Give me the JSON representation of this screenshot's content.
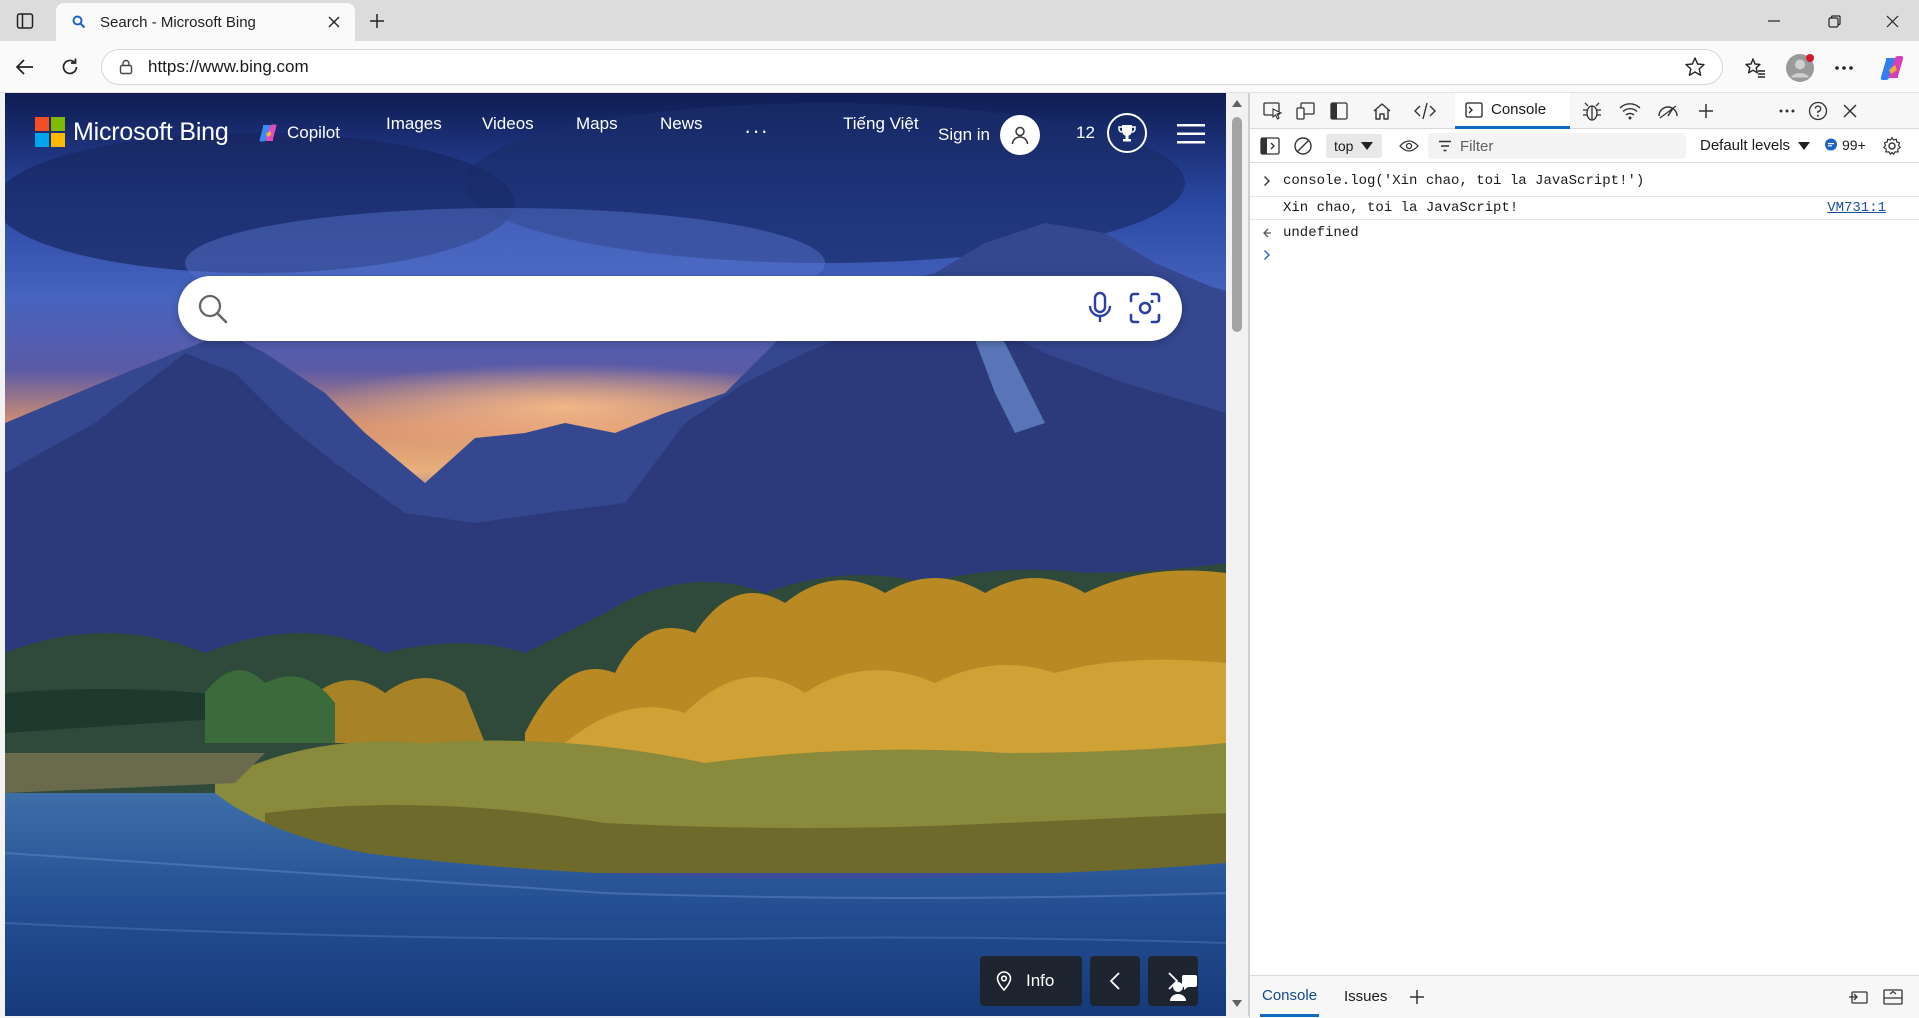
{
  "browser": {
    "tab": {
      "title": "Search - Microsoft Bing"
    },
    "address": {
      "url": "https://www.bing.com"
    },
    "icons": {
      "sidebar": "sidebar-toggle-icon",
      "favicon": "search-icon",
      "close": "close-icon",
      "new_tab": "plus-icon",
      "minimize": "minimize-icon",
      "restore": "restore-icon",
      "window_close": "close-icon",
      "back": "arrow-left-icon",
      "refresh": "refresh-icon",
      "lock": "lock-icon",
      "favorite": "star-icon",
      "favorites": "favorites-icon",
      "profile": "profile-icon",
      "more": "more-icon",
      "copilot": "copilot-icon"
    }
  },
  "bing": {
    "brand": "Microsoft Bing",
    "nav": {
      "copilot": "Copilot",
      "images": "Images",
      "videos": "Videos",
      "maps": "Maps",
      "news": "News",
      "more": "···"
    },
    "language": "Tiếng Việt",
    "sign_in": "Sign in",
    "rewards_points": "12",
    "search": {
      "placeholder": "",
      "value": ""
    },
    "info_label": "Info",
    "colors": {
      "ms_red": "#f25022",
      "ms_green": "#7fba00",
      "ms_blue": "#00a4ef",
      "ms_yellow": "#ffb900"
    }
  },
  "devtools": {
    "tabs": {
      "console": "Console"
    },
    "filter": {
      "context": "top",
      "placeholder": "Filter",
      "levels": "Default levels",
      "issues": "99+"
    },
    "console": {
      "input_prefix": "console.log(",
      "input_string": "'Xin chao, toi la JavaScript!'",
      "input_suffix": ")",
      "output": "Xin chao, toi la JavaScript!",
      "output_source": "VM731:1",
      "return_value": "undefined"
    },
    "drawer": {
      "console": "Console",
      "issues": "Issues"
    },
    "accent": "#0f6cbd"
  }
}
